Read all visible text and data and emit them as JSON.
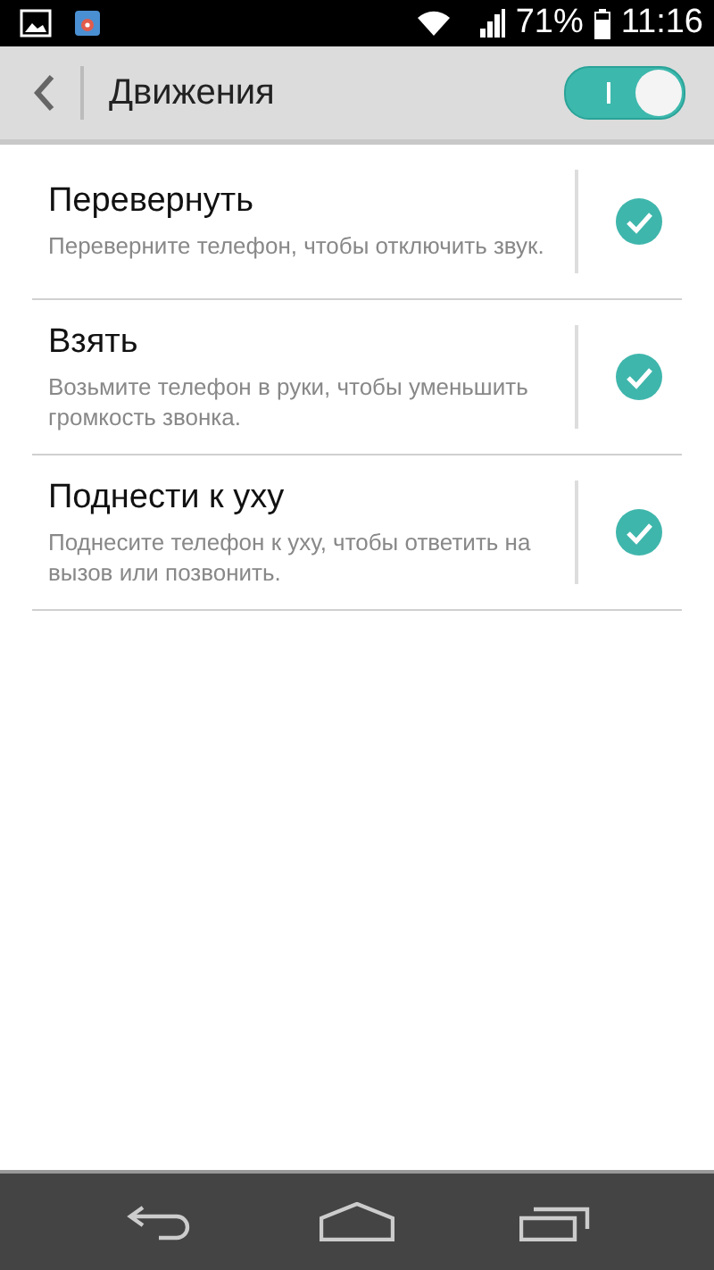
{
  "status_bar": {
    "battery": "71%",
    "time": "11:16"
  },
  "header": {
    "title": "Движения",
    "master_switch": {
      "on": true
    }
  },
  "items": [
    {
      "title": "Перевернуть",
      "description": "Переверните телефон, чтобы отключить звук.",
      "checked": true
    },
    {
      "title": "Взять",
      "description": "Возьмите телефон в руки, чтобы уменьшить громкость звонка.",
      "checked": true
    },
    {
      "title": "Поднести к уху",
      "description": "Поднесите телефон к уху, чтобы ответить на вызов или позвонить.",
      "checked": true
    }
  ]
}
